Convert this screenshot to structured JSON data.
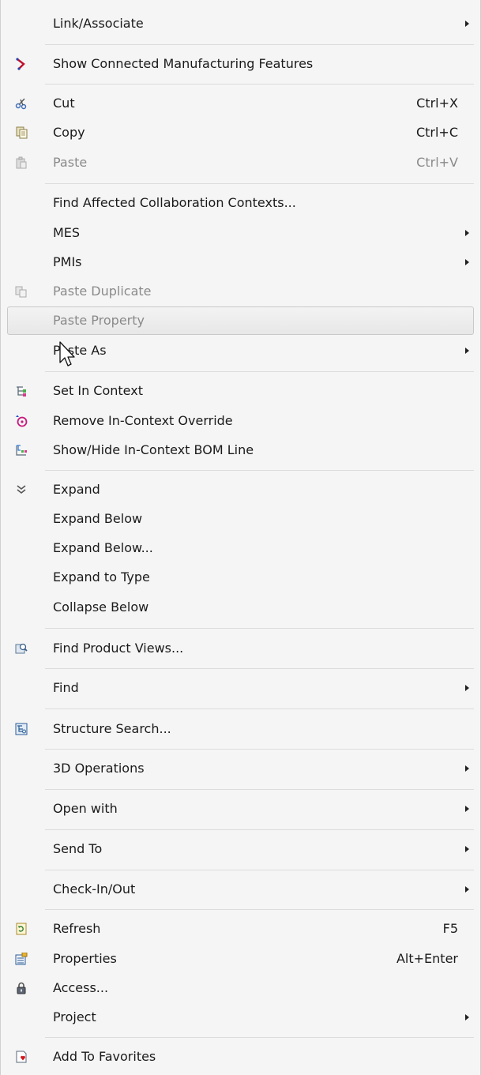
{
  "menu": {
    "items": [
      {
        "label": "Link/Associate"
      },
      {
        "label": "Show Connected Manufacturing Features",
        "icon": "connected-features-icon"
      },
      {
        "label": "Cut",
        "shortcut": "Ctrl+X",
        "icon": "scissors-icon"
      },
      {
        "label": "Copy",
        "shortcut": "Ctrl+C",
        "icon": "copy-icon"
      },
      {
        "label": "Paste",
        "shortcut": "Ctrl+V",
        "icon": "paste-icon",
        "disabled": true
      },
      {
        "label": "Find Affected Collaboration Contexts..."
      },
      {
        "label": "MES"
      },
      {
        "label": "PMIs"
      },
      {
        "label": "Paste Duplicate",
        "icon": "paste-duplicate-icon",
        "disabled": true
      },
      {
        "label": "Paste Property",
        "disabled": true,
        "highlighted": true
      },
      {
        "label": "Paste As"
      },
      {
        "label": "Set In Context",
        "icon": "set-context-icon"
      },
      {
        "label": "Remove In-Context Override",
        "icon": "remove-override-icon"
      },
      {
        "label": "Show/Hide In-Context BOM Line",
        "icon": "bom-line-icon"
      },
      {
        "label": "Expand",
        "icon": "double-chevron-down-icon"
      },
      {
        "label": "Expand Below"
      },
      {
        "label": "Expand Below..."
      },
      {
        "label": "Expand to Type"
      },
      {
        "label": "Collapse Below"
      },
      {
        "label": "Find Product Views...",
        "icon": "product-views-icon"
      },
      {
        "label": "Find"
      },
      {
        "label": "Structure Search...",
        "icon": "structure-search-icon"
      },
      {
        "label": "3D Operations"
      },
      {
        "label": "Open with"
      },
      {
        "label": "Send To"
      },
      {
        "label": "Check-In/Out"
      },
      {
        "label": "Refresh",
        "shortcut": "F5",
        "icon": "refresh-icon"
      },
      {
        "label": "Properties",
        "shortcut": "Alt+Enter",
        "icon": "properties-icon"
      },
      {
        "label": "Access...",
        "icon": "lock-icon"
      },
      {
        "label": "Project"
      },
      {
        "label": "Add To Favorites",
        "icon": "favorites-icon"
      }
    ]
  },
  "colors": {
    "background": "#f5f5f5",
    "highlight": "#e9e9e9",
    "separator": "#dcdcdc",
    "disabled_text": "#8a8a8a"
  }
}
